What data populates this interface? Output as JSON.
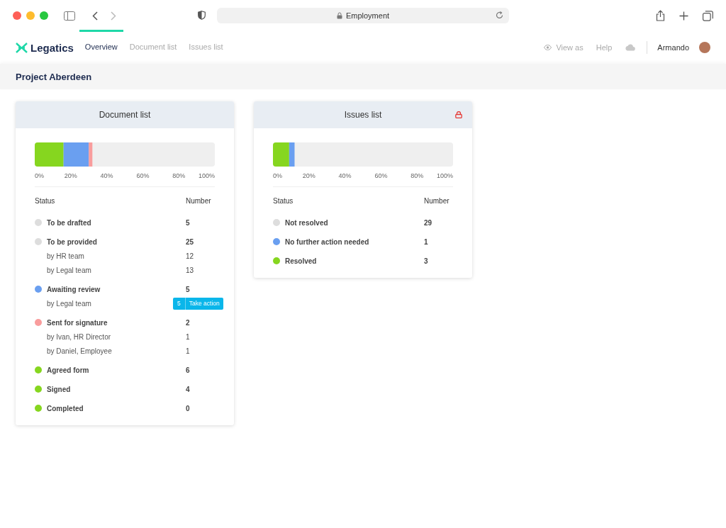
{
  "browser": {
    "address": "Employment"
  },
  "nav": {
    "brand": "Legatics",
    "tabs": [
      {
        "label": "Overview",
        "selected": true
      },
      {
        "label": "Document list",
        "selected": false
      },
      {
        "label": "Issues list",
        "selected": false
      }
    ],
    "view_as": "View as",
    "help": "Help",
    "user": "Armando"
  },
  "project": {
    "title": "Project Aberdeen"
  },
  "cards": [
    {
      "title": "Document list",
      "locked": false,
      "chart_data": {
        "type": "bar",
        "orientation": "horizontal",
        "stacked": true,
        "xlim": [
          0,
          100
        ],
        "xticks": [
          {
            "value": 0,
            "label": "0%"
          },
          {
            "value": 20,
            "label": "20%"
          },
          {
            "value": 40,
            "label": "40%"
          },
          {
            "value": 60,
            "label": "60%"
          },
          {
            "value": 80,
            "label": "80%"
          },
          {
            "value": 100,
            "label": "100%"
          }
        ],
        "series": [
          {
            "color": "#86d61f",
            "values": [
              16
            ]
          },
          {
            "color": "#6a9ff0",
            "values": [
              14
            ]
          },
          {
            "color": "#f99d9d",
            "values": [
              2
            ]
          }
        ]
      },
      "columns": [
        "Status",
        "Number"
      ],
      "rows": [
        {
          "kind": "status",
          "label": "To be drafted",
          "number": "5",
          "color": "#dddddd"
        },
        {
          "kind": "status",
          "label": "To be provided",
          "number": "25",
          "color": "#dddddd"
        },
        {
          "kind": "sub",
          "label": "by HR team",
          "number": "12"
        },
        {
          "kind": "sub",
          "label": "by Legal team",
          "number": "13"
        },
        {
          "kind": "status",
          "label": "Awaiting review",
          "number": "5",
          "color": "#6a9ff0"
        },
        {
          "kind": "action",
          "label": "by Legal team",
          "number": "5",
          "action": "Take action"
        },
        {
          "kind": "status",
          "label": "Sent for signature",
          "number": "2",
          "color": "#f99d9d"
        },
        {
          "kind": "sub",
          "label": "by Ivan, HR Director",
          "number": "1"
        },
        {
          "kind": "sub",
          "label": "by Daniel, Employee",
          "number": "1"
        },
        {
          "kind": "status",
          "label": "Agreed form",
          "number": "6",
          "color": "#86d61f"
        },
        {
          "kind": "status",
          "label": "Signed",
          "number": "4",
          "color": "#86d61f"
        },
        {
          "kind": "status",
          "label": "Completed",
          "number": "0",
          "color": "#86d61f"
        }
      ]
    },
    {
      "title": "Issues list",
      "locked": true,
      "chart_data": {
        "type": "bar",
        "orientation": "horizontal",
        "stacked": true,
        "xlim": [
          0,
          100
        ],
        "xticks": [
          {
            "value": 0,
            "label": "0%"
          },
          {
            "value": 20,
            "label": "20%"
          },
          {
            "value": 40,
            "label": "40%"
          },
          {
            "value": 60,
            "label": "60%"
          },
          {
            "value": 80,
            "label": "80%"
          },
          {
            "value": 100,
            "label": "100%"
          }
        ],
        "series": [
          {
            "color": "#86d61f",
            "values": [
              9
            ]
          },
          {
            "color": "#6a9ff0",
            "values": [
              3
            ]
          }
        ]
      },
      "columns": [
        "Status",
        "Number"
      ],
      "rows": [
        {
          "kind": "status",
          "label": "Not resolved",
          "number": "29",
          "color": "#dddddd"
        },
        {
          "kind": "status",
          "label": "No further action needed",
          "number": "1",
          "color": "#6a9ff0"
        },
        {
          "kind": "status",
          "label": "Resolved",
          "number": "3",
          "color": "#86d61f"
        }
      ]
    }
  ]
}
